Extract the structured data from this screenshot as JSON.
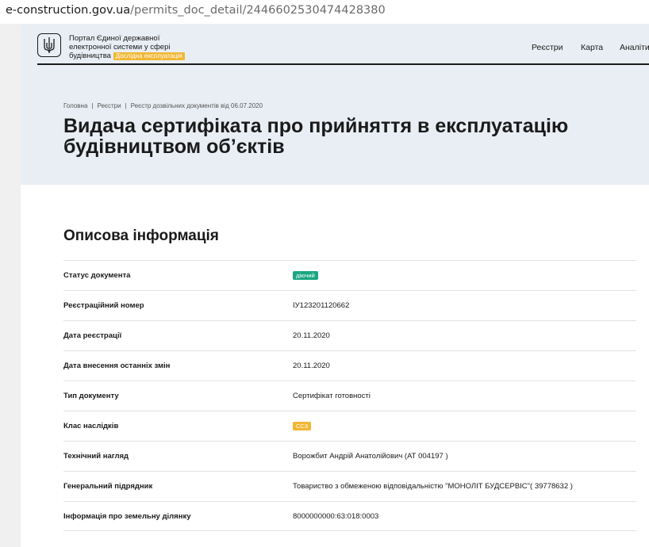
{
  "browser": {
    "url_host": "e-construction.gov.ua",
    "url_path": "/permits_doc_detail/2446602530474428380"
  },
  "header": {
    "portal_line1": "Портал Єдиної державної",
    "portal_line2": "електронної системи у сфері",
    "portal_line3": "будівництва",
    "portal_badge": "Дослідна експлуатація",
    "nav": [
      "Реєстри",
      "Карта",
      "Аналіти"
    ]
  },
  "breadcrumb": [
    "Головна",
    "Реєстри",
    "Реєстр дозвільних документів від 06.07.2020"
  ],
  "page_title_line1": "Видача сертифіката про прийняття в експлуатацію",
  "page_title_line2": "будівництвом об’єктів",
  "section": {
    "title": "Описова інформація",
    "rows": [
      {
        "label": "Статус документа",
        "value": "діючий",
        "type": "pill",
        "color": "#1aa682"
      },
      {
        "label": "Реєстраційний номер",
        "value": "ІУ123201120662",
        "type": "text"
      },
      {
        "label": "Дата реєстрації",
        "value": "20.11.2020",
        "type": "text"
      },
      {
        "label": "Дата внесення останніх змін",
        "value": "20.11.2020",
        "type": "text"
      },
      {
        "label": "Тип документу",
        "value": "Сертифікат готовності",
        "type": "text"
      },
      {
        "label": "Клас наслідків",
        "value": "СС3",
        "type": "pill",
        "color": "#f2b632"
      },
      {
        "label": "Технічний нагляд",
        "value": "Ворожбит Андрій Анатолійович (АТ 004197 )",
        "type": "text"
      },
      {
        "label": "Генеральний підрядник",
        "value": "Товариство з обмеженою відповідальністю \"МОНОЛІТ БУДСЕРВІС\"( 39778632 )",
        "type": "text"
      },
      {
        "label": "Інформація про земельну ділянку",
        "value": "8000000000:63:018:0003",
        "type": "text"
      }
    ]
  },
  "colors": {
    "hero_bg": "#e9eef4",
    "accent_yellow": "#f2b632",
    "status_green": "#1aa682"
  }
}
